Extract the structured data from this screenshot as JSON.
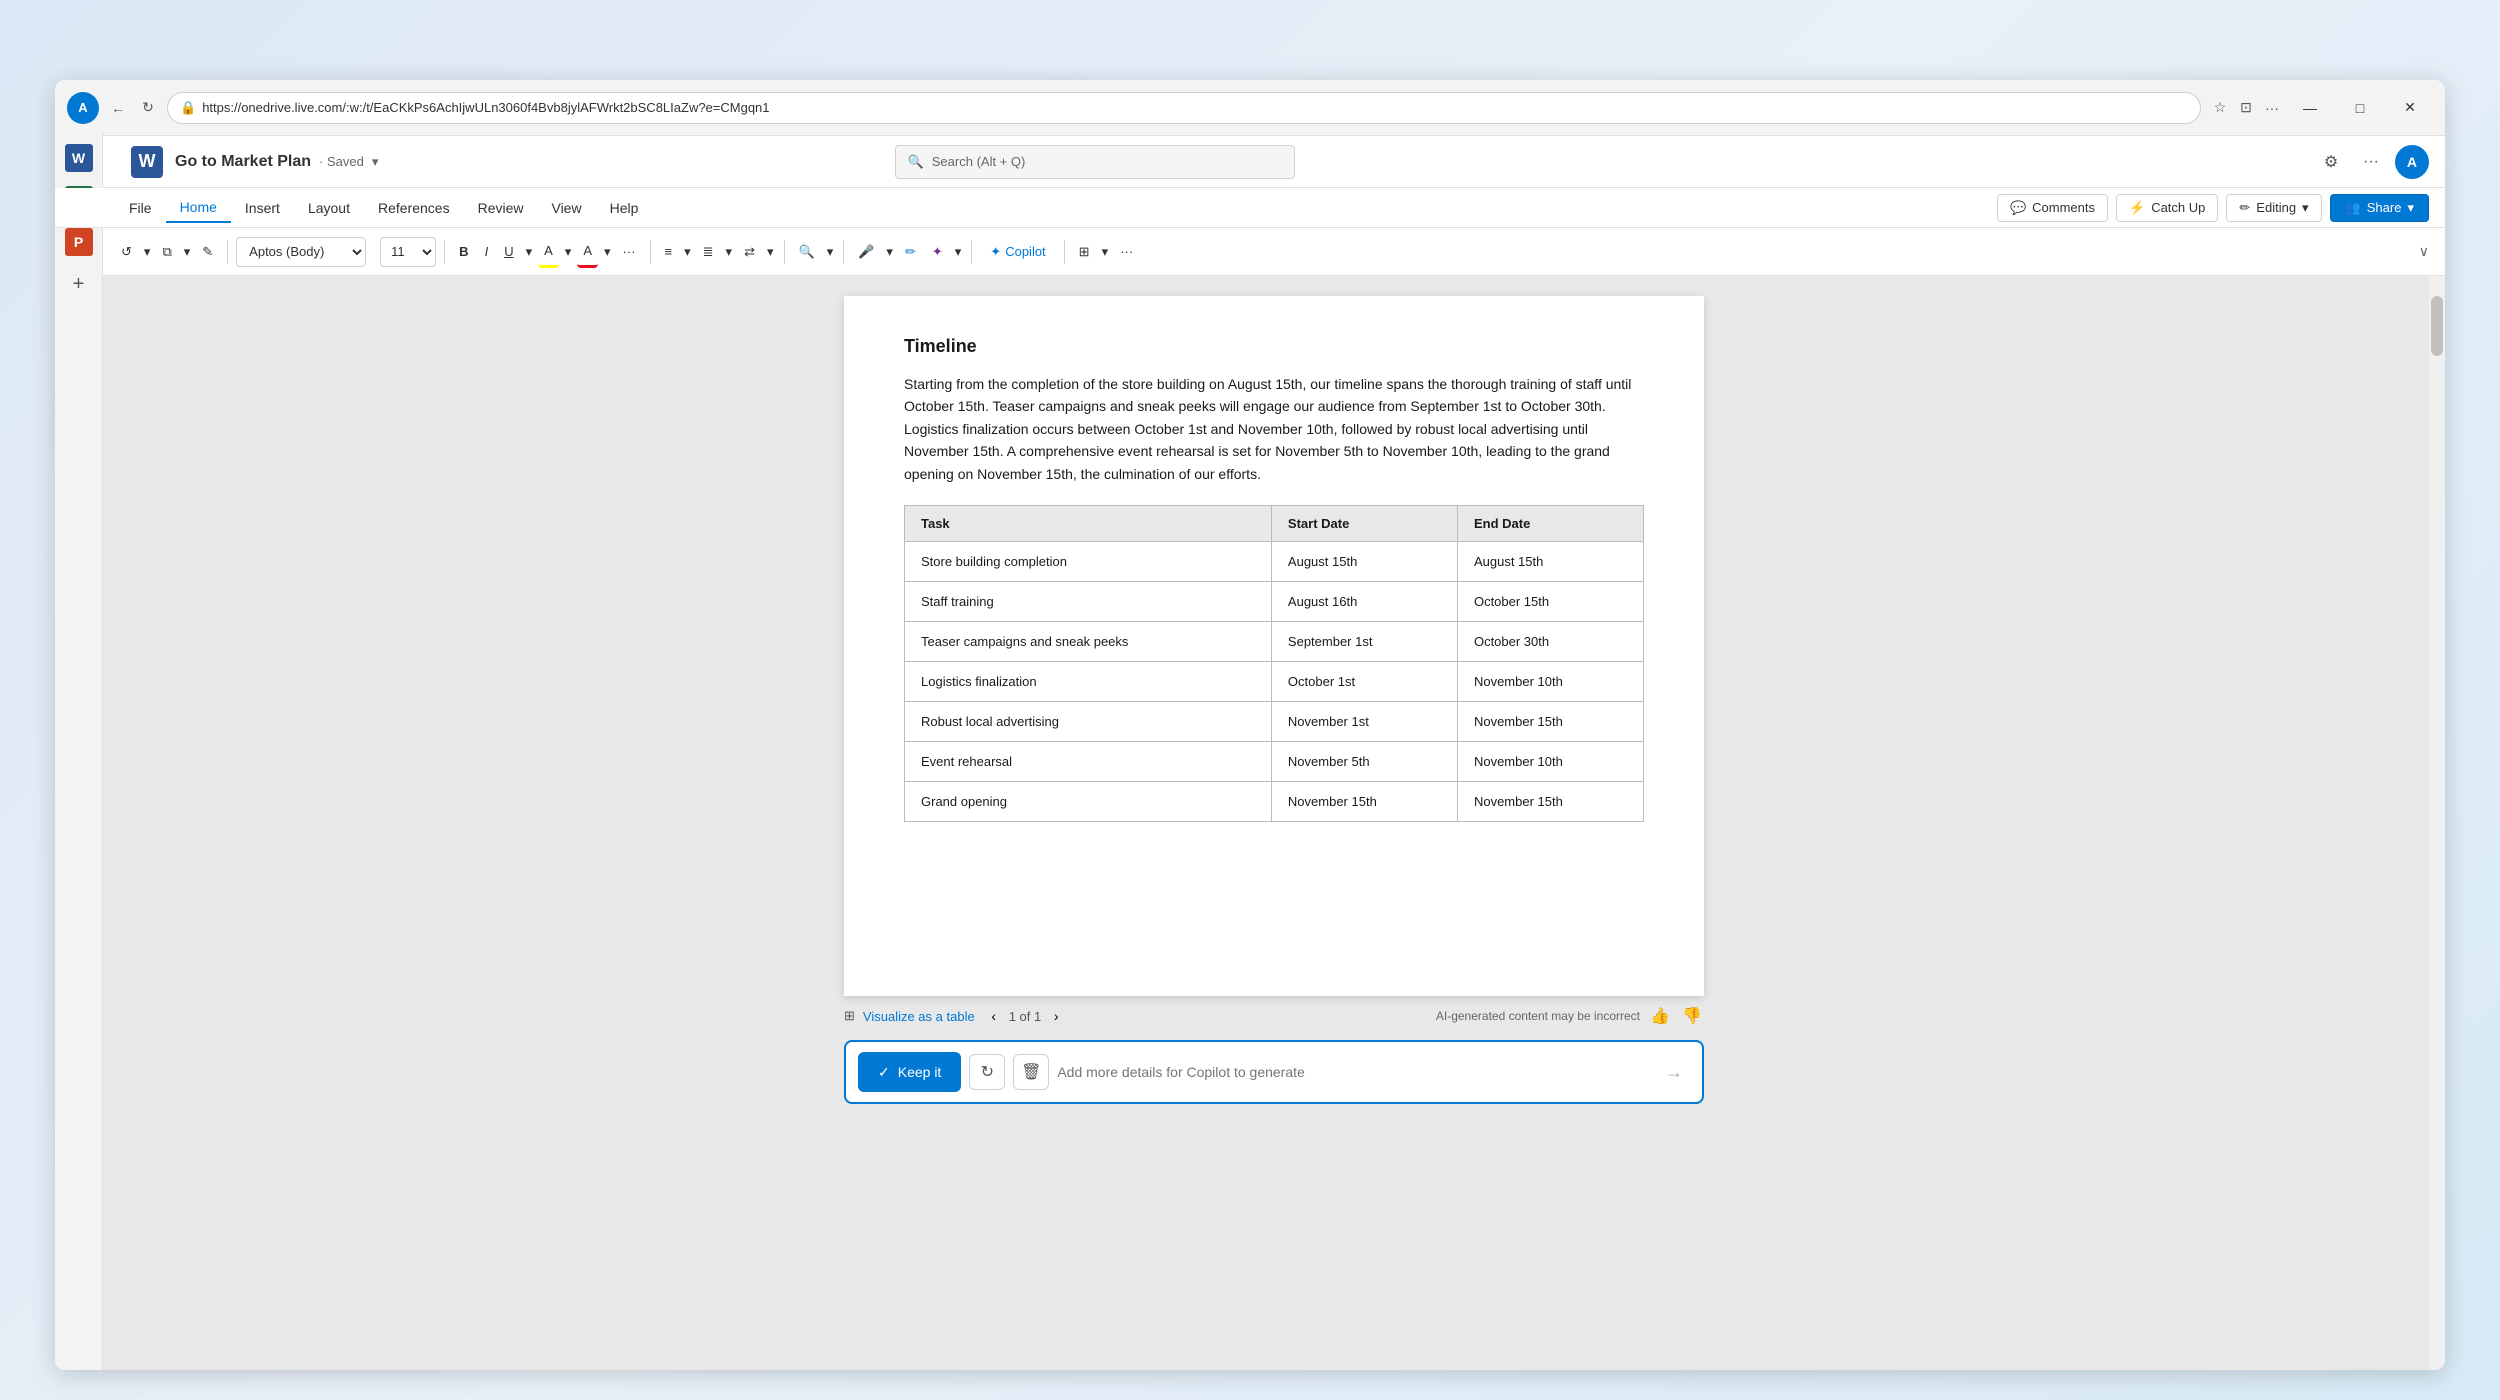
{
  "browser": {
    "url": "https://onedrive.live.com/:w:/t/EaCKkPs6AchIjwULn3060f4Bvb8jylAFWrkt2bSC8LIaZw?e=CMgqn1",
    "favicon_icon": "W",
    "window_controls": {
      "minimize": "—",
      "maximize": "□",
      "close": "✕"
    }
  },
  "app_bar": {
    "app_logo": "W",
    "doc_title": "Go to Market Plan",
    "saved_label": "· Saved",
    "search_placeholder": "Search (Alt + Q)",
    "settings_icon": "⚙",
    "more_icon": "···",
    "user_avatar": "A"
  },
  "side_icons": {
    "grid_icon": "⊞",
    "word_label": "W",
    "excel_label": "X",
    "ppt_label": "P",
    "add_icon": "+"
  },
  "menu": {
    "items": [
      {
        "id": "file",
        "label": "File"
      },
      {
        "id": "home",
        "label": "Home"
      },
      {
        "id": "insert",
        "label": "Insert"
      },
      {
        "id": "layout",
        "label": "Layout"
      },
      {
        "id": "references",
        "label": "References"
      },
      {
        "id": "review",
        "label": "Review"
      },
      {
        "id": "view",
        "label": "View"
      },
      {
        "id": "help",
        "label": "Help"
      }
    ],
    "active": "home",
    "comments_label": "Comments",
    "catchup_label": "Catch Up",
    "editing_label": "Editing",
    "share_label": "Share"
  },
  "format_bar": {
    "undo_label": "↺",
    "redo_label": "→",
    "clipboard_label": "⧉",
    "format_painter_label": "✎",
    "font_name": "Aptos (Body)",
    "font_size": "11",
    "bold_label": "B",
    "italic_label": "I",
    "underline_label": "U",
    "highlight_label": "A",
    "font_color_label": "A",
    "more_label": "···",
    "bullets_label": "≡",
    "align_label": "≣",
    "text_dir_label": "⇄",
    "search_doc_label": "🔍",
    "dictate_label": "🎤",
    "editor_label": "✏",
    "designer_label": "✦",
    "copilot_label": "Copilot",
    "table_label": "⊞",
    "overflow_label": "···",
    "expand_label": "∨"
  },
  "document": {
    "timeline_heading": "Timeline",
    "timeline_paragraph": "Starting from the completion of the store building on August 15th, our timeline spans the thorough training of staff until October 15th. Teaser campaigns and sneak peeks will engage our audience from September 1st to October 30th. Logistics finalization occurs between October 1st and November 10th, followed by robust local advertising until November 15th. A comprehensive event rehearsal is set for November 5th to November 10th, leading to the grand opening on November 15th, the culmination of our efforts.",
    "table": {
      "columns": [
        "Task",
        "Start Date",
        "End Date"
      ],
      "rows": [
        {
          "task": "Store building completion",
          "start": "August 15th",
          "end": "August 15th"
        },
        {
          "task": "Staff training",
          "start": "August 16th",
          "end": "October 15th"
        },
        {
          "task": "Teaser campaigns and sneak peeks",
          "start": "September 1st",
          "end": "October 30th"
        },
        {
          "task": "Logistics finalization",
          "start": "October 1st",
          "end": "November 10th"
        },
        {
          "task": "Robust local advertising",
          "start": "November 1st",
          "end": "November 15th"
        },
        {
          "task": "Event rehearsal",
          "start": "November 5th",
          "end": "November 10th"
        },
        {
          "task": "Grand opening",
          "start": "November 15th",
          "end": "November 15th"
        }
      ]
    }
  },
  "ai_toolbar": {
    "visualize_label": "Visualize as a table",
    "page_label": "1 of 1",
    "ai_disclaimer": "AI-generated content may be incorrect",
    "thumbs_up": "👍",
    "thumbs_down": "👎"
  },
  "copilot_bar": {
    "keep_label": "Keep it",
    "keep_icon": "✓",
    "refresh_icon": "↻",
    "delete_icon": "🗑",
    "input_placeholder": "Add more details for Copilot to generate",
    "send_icon": "→"
  }
}
